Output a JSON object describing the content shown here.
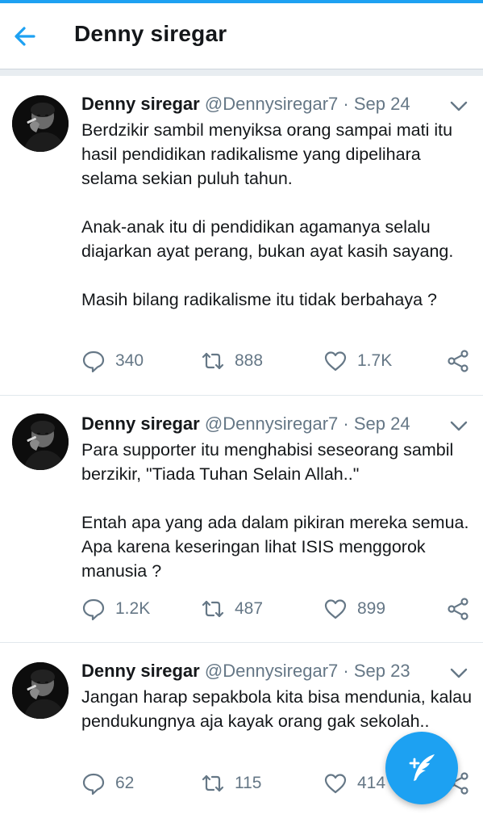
{
  "header": {
    "title": "Denny siregar"
  },
  "icons": {
    "back": "arrow-left",
    "caret": "chevron-down",
    "reply": "speech-bubble",
    "retweet": "retweet-arrows",
    "like": "heart",
    "share": "share-nodes",
    "compose": "feather-plus"
  },
  "colors": {
    "accent": "#1da1f2",
    "text": "#14171a",
    "muted": "#657786",
    "divider": "#e1e8ed"
  },
  "tweets": [
    {
      "name": "Denny siregar",
      "handle": "@Dennysiregar7",
      "separator": "·",
      "date": "Sep 24",
      "paragraphs": [
        "Berdzikir sambil menyiksa orang sampai mati itu hasil pendidikan radikalisme yang dipelihara selama sekian puluh tahun.",
        "Anak-anak itu di pendidikan agamanya selalu diajarkan ayat perang, bukan ayat kasih sayang.",
        "Masih bilang radikalisme itu tidak berbahaya ?"
      ],
      "replies": "340",
      "retweets": "888",
      "likes": "1.7K"
    },
    {
      "name": "Denny siregar",
      "handle": "@Dennysiregar7",
      "separator": "·",
      "date": "Sep 24",
      "paragraphs": [
        "Para supporter itu menghabisi seseorang sambil berzikir, \"Tiada Tuhan Selain Allah..\"",
        "Entah apa yang ada dalam pikiran mereka semua. Apa karena keseringan lihat ISIS menggorok manusia ?"
      ],
      "replies": "1.2K",
      "retweets": "487",
      "likes": "899"
    },
    {
      "name": "Denny siregar",
      "handle": "@Dennysiregar7",
      "separator": "·",
      "date": "Sep 23",
      "paragraphs": [
        "Jangan harap sepakbola kita bisa mendunia, kalau pendukungnya aja kayak orang gak sekolah.."
      ],
      "replies": "62",
      "retweets": "115",
      "likes": "414"
    }
  ]
}
